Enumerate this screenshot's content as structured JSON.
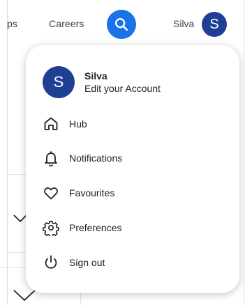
{
  "nav": {
    "partial_link": "ps",
    "careers": "Careers",
    "search_icon": "search-icon",
    "user_name": "Silva",
    "avatar_initial": "S"
  },
  "menu": {
    "account": {
      "avatar_initial": "S",
      "name": "Silva",
      "subtitle": "Edit your Account"
    },
    "items": [
      {
        "label": "Hub",
        "icon": "home-icon"
      },
      {
        "label": "Notifications",
        "icon": "bell-icon"
      },
      {
        "label": "Favourites",
        "icon": "heart-icon"
      },
      {
        "label": "Preferences",
        "icon": "gear-icon"
      },
      {
        "label": "Sign out",
        "icon": "power-icon"
      }
    ]
  },
  "colors": {
    "accent": "#1a73e8",
    "avatar": "#1f3f94"
  }
}
